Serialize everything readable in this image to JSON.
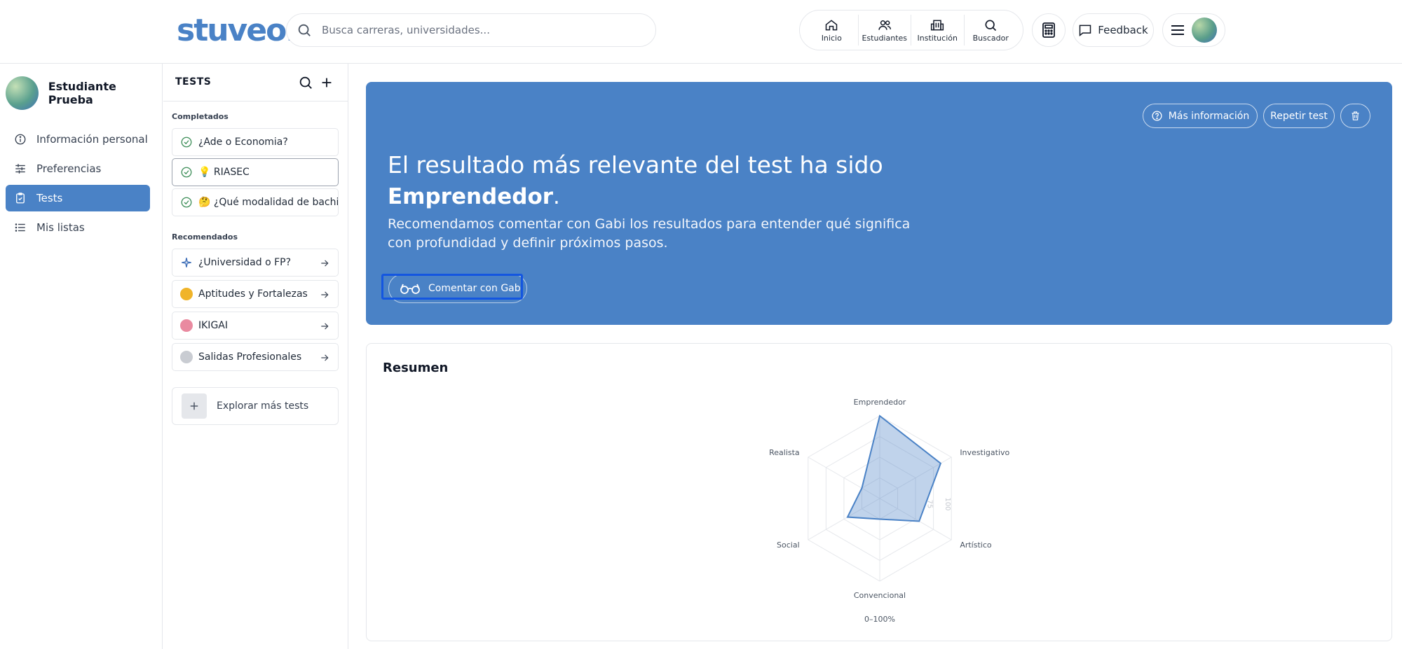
{
  "app": {
    "logo": "stuveo."
  },
  "search": {
    "placeholder": "Busca carreras, universidades..."
  },
  "nav": {
    "items": [
      {
        "label": "Inicio",
        "icon": "home-icon"
      },
      {
        "label": "Estudiantes",
        "icon": "users-icon"
      },
      {
        "label": "Institución",
        "icon": "building-icon"
      },
      {
        "label": "Buscador",
        "icon": "search-icon"
      }
    ],
    "feedback_label": "Feedback"
  },
  "sidebar": {
    "user_name": "Estudiante Prueba",
    "items": [
      {
        "label": "Información personal",
        "icon": "info-icon",
        "active": false
      },
      {
        "label": "Preferencias",
        "icon": "sliders-icon",
        "active": false
      },
      {
        "label": "Tests",
        "icon": "clipboard-check-icon",
        "active": true
      },
      {
        "label": "Mis listas",
        "icon": "list-icon",
        "active": false
      }
    ]
  },
  "tests_panel": {
    "title": "TESTS",
    "completed_label": "Completados",
    "completed": [
      {
        "label": "¿Ade o Economia?"
      },
      {
        "label": "💡 RIASEC",
        "selected": true
      },
      {
        "label": "🤔 ¿Qué modalidad de bachillerato?"
      }
    ],
    "recommended_label": "Recomendados",
    "recommended": [
      {
        "label": "¿Universidad o FP?"
      },
      {
        "label": "Aptitudes y Fortalezas"
      },
      {
        "label": "IKIGAI"
      },
      {
        "label": "Salidas Profesionales"
      }
    ],
    "explore_label": "Explorar más tests"
  },
  "hero": {
    "info_button": "Más información",
    "repeat_button": "Repetir test",
    "title": "El resultado más relevante del test ha sido",
    "result": "Emprendedor",
    "result_suffix": ".",
    "description": "Recomendamos comentar con Gabi los resultados para entender qué significa con profundidad y definir próximos pasos.",
    "gabi_button": "Comentar con Gabi",
    "background": "#4a82c6"
  },
  "summary": {
    "title": "Resumen",
    "scale_label": "0–100%"
  },
  "chart_data": {
    "type": "radar",
    "axes": [
      "Emprendedor",
      "Investigativo",
      "Artístico",
      "Convencional",
      "Social",
      "Realista"
    ],
    "values": [
      100,
      85,
      55,
      25,
      45,
      25
    ],
    "range": [
      0,
      100
    ],
    "tick_labels": [
      "75",
      "100"
    ],
    "fill_color": "#4a82c6"
  }
}
